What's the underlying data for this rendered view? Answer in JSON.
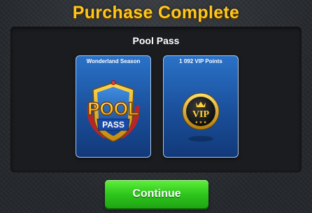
{
  "dialog": {
    "title": "Purchase Complete",
    "item_name": "Pool Pass"
  },
  "rewards": [
    {
      "label": "Wonderland Season",
      "badge_text_top": "POOL",
      "badge_text_bottom": "PASS",
      "icon": "pool-pass-badge-icon"
    },
    {
      "label": "1 092 VIP Points",
      "badge_text": "VIP",
      "icon": "vip-coin-icon"
    }
  ],
  "continue_button": {
    "label": "Continue"
  },
  "colors": {
    "title": "#ffc61c",
    "button": "#2ec71c",
    "card": "#1a4f9a"
  }
}
